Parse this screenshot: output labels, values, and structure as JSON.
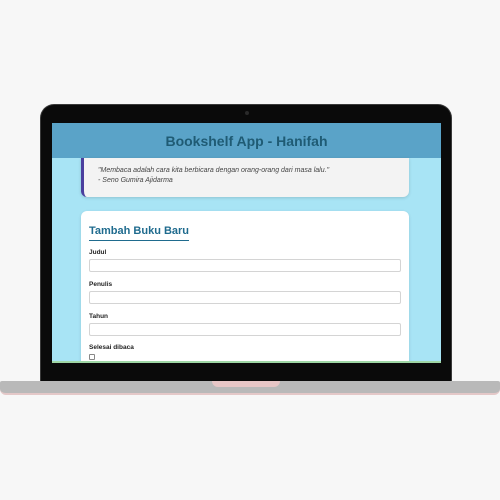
{
  "app": {
    "title": "Bookshelf App - Hanifah"
  },
  "quote": {
    "text": "\"Membaca adalah cara kita berbicara dengan orang-orang dari masa lalu.\"",
    "author": "- Seno Gumira Ajidarma"
  },
  "form": {
    "title": "Tambah Buku Baru",
    "fields": [
      {
        "label": "Judul",
        "value": ""
      },
      {
        "label": "Penulis",
        "value": ""
      },
      {
        "label": "Tahun",
        "value": ""
      }
    ],
    "checkbox_label": "Selesai dibaca",
    "checkbox_checked": false
  },
  "colors": {
    "header_bg": "#5aa3c8",
    "header_text": "#1f5b74",
    "page_bg": "#a8e4f5",
    "accent": "#1f6b8e",
    "quote_border": "#4a3f9e"
  },
  "icons": [
    "laptop-frame"
  ]
}
